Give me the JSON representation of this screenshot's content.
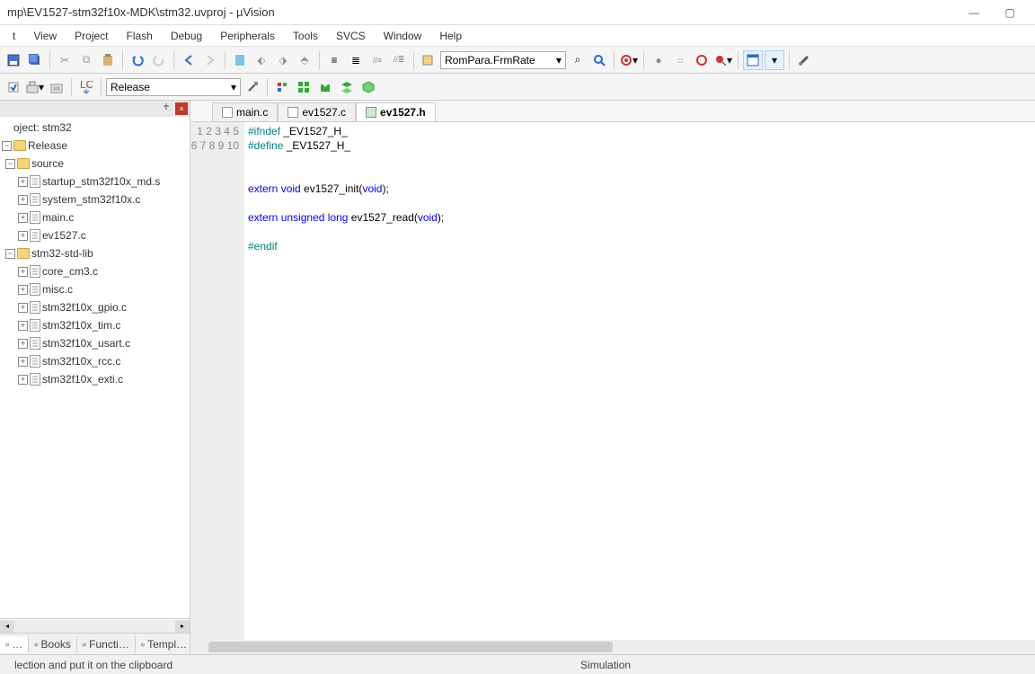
{
  "title": "mp\\EV1527-stm32f10x-MDK\\stm32.uvproj - µVision",
  "menu": [
    "t",
    "View",
    "Project",
    "Flash",
    "Debug",
    "Peripherals",
    "Tools",
    "SVCS",
    "Window",
    "Help"
  ],
  "toolbar": {
    "combo1": "RomPara.FrmRate",
    "target": "Release"
  },
  "project": {
    "root": "oject: stm32",
    "config": "Release",
    "groups": [
      {
        "name": "source",
        "files": [
          "startup_stm32f10x_md.s",
          "system_stm32f10x.c",
          "main.c",
          "ev1527.c"
        ]
      },
      {
        "name": "stm32-std-lib",
        "files": [
          "core_cm3.c",
          "misc.c",
          "stm32f10x_gpio.c",
          "stm32f10x_tim.c",
          "stm32f10x_usart.c",
          "stm32f10x_rcc.c",
          "stm32f10x_exti.c"
        ]
      }
    ]
  },
  "bottom_tabs": [
    "…",
    "Books",
    "Functi…",
    "Templ…"
  ],
  "file_tabs": [
    {
      "label": "main.c",
      "kind": "c",
      "active": false
    },
    {
      "label": "ev1527.c",
      "kind": "c",
      "active": false
    },
    {
      "label": "ev1527.h",
      "kind": "h",
      "active": true
    }
  ],
  "code": {
    "lines": [
      {
        "n": 1,
        "tokens": [
          [
            "pp",
            "#ifndef"
          ],
          [
            "txt",
            " _EV1527_H_"
          ]
        ]
      },
      {
        "n": 2,
        "tokens": [
          [
            "pp",
            "#define"
          ],
          [
            "txt",
            " _EV1527_H_"
          ]
        ]
      },
      {
        "n": 3,
        "tokens": []
      },
      {
        "n": 4,
        "tokens": []
      },
      {
        "n": 5,
        "tokens": [
          [
            "blue",
            "extern"
          ],
          [
            "txt",
            " "
          ],
          [
            "blue",
            "void"
          ],
          [
            "txt",
            " ev1527_init("
          ],
          [
            "blue",
            "void"
          ],
          [
            "txt",
            ");"
          ]
        ]
      },
      {
        "n": 6,
        "tokens": []
      },
      {
        "n": 7,
        "tokens": [
          [
            "blue",
            "extern"
          ],
          [
            "txt",
            " "
          ],
          [
            "blue",
            "unsigned"
          ],
          [
            "txt",
            " "
          ],
          [
            "blue",
            "long"
          ],
          [
            "txt",
            " ev1527_read("
          ],
          [
            "blue",
            "void"
          ],
          [
            "txt",
            ");"
          ]
        ]
      },
      {
        "n": 8,
        "tokens": []
      },
      {
        "n": 9,
        "tokens": [
          [
            "pp",
            "#endif"
          ]
        ]
      },
      {
        "n": 10,
        "tokens": []
      }
    ]
  },
  "status": {
    "left": "lection and put it on the clipboard",
    "mode": "Simulation"
  }
}
